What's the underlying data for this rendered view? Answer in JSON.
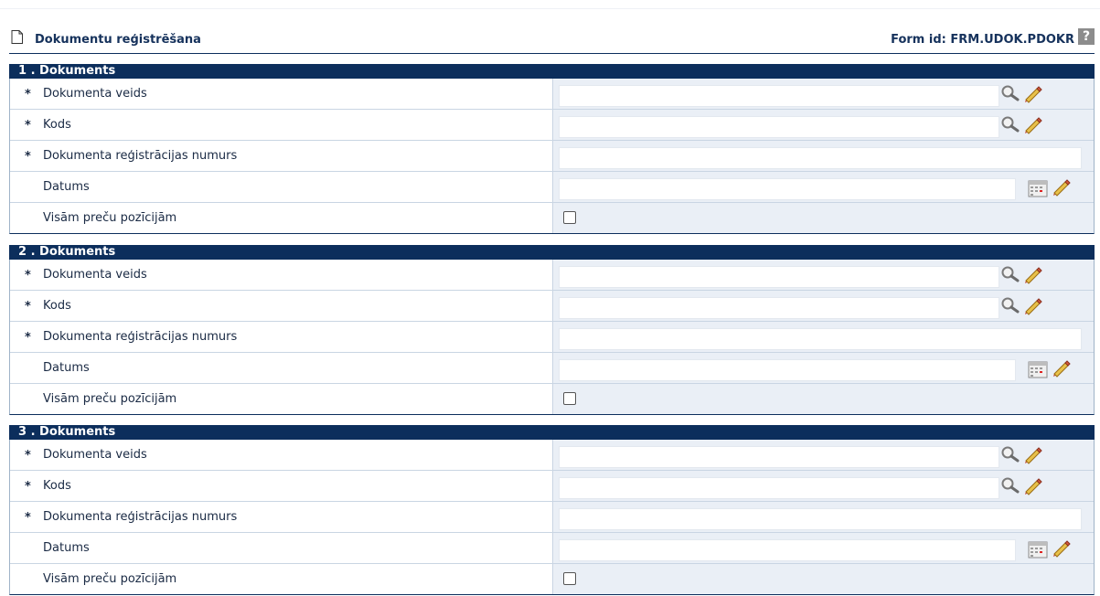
{
  "header": {
    "title": "Dokumentu reģistrēšana",
    "form_id": "Form id: FRM.UDOK.PDOKR",
    "help_symbol": "?"
  },
  "sections": [
    {
      "title": "1 . Dokuments",
      "fields": [
        {
          "required": "*",
          "label": "Dokumenta veids",
          "value": ""
        },
        {
          "required": "*",
          "label": "Kods",
          "value": ""
        },
        {
          "required": "*",
          "label": "Dokumenta reģistrācijas numurs",
          "value": ""
        },
        {
          "required": "",
          "label": "Datums",
          "value": ""
        },
        {
          "required": "",
          "label": "Visām preču pozīcijām",
          "checked": false
        }
      ]
    },
    {
      "title": "2 . Dokuments",
      "fields": [
        {
          "required": "*",
          "label": "Dokumenta veids",
          "value": ""
        },
        {
          "required": "*",
          "label": "Kods",
          "value": ""
        },
        {
          "required": "*",
          "label": "Dokumenta reģistrācijas numurs",
          "value": ""
        },
        {
          "required": "",
          "label": "Datums",
          "value": ""
        },
        {
          "required": "",
          "label": "Visām preču pozīcijām",
          "checked": false
        }
      ]
    },
    {
      "title": "3 . Dokuments",
      "fields": [
        {
          "required": "*",
          "label": "Dokumenta veids",
          "value": ""
        },
        {
          "required": "*",
          "label": "Kods",
          "value": ""
        },
        {
          "required": "*",
          "label": "Dokumenta reģistrācijas numurs",
          "value": ""
        },
        {
          "required": "",
          "label": "Datums",
          "value": ""
        },
        {
          "required": "",
          "label": "Visām preču pozīcijām",
          "checked": false
        }
      ]
    }
  ],
  "colors": {
    "section_header_bg": "#0c2e5c",
    "value_cell_bg": "#eaeff6",
    "title_text": "#16325c"
  },
  "icons": [
    "document-icon",
    "help-icon",
    "search-icon",
    "eraser-icon",
    "calendar-icon"
  ]
}
